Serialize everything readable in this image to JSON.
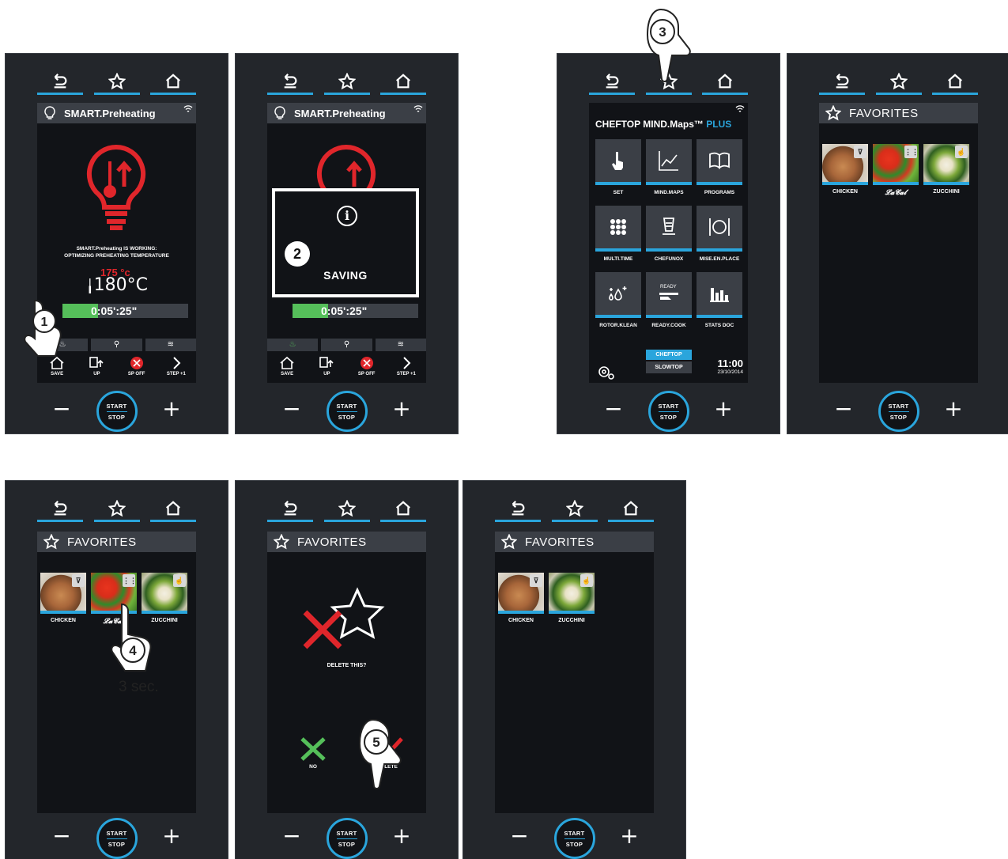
{
  "nav": {
    "back_icon": "back-icon",
    "star_icon": "star-icon",
    "home_icon": "home-icon"
  },
  "control": {
    "minus": "−",
    "plus": "+",
    "start": "START",
    "stop": "STOP"
  },
  "colors": {
    "accent": "#2aa5dc",
    "danger": "#e0262b",
    "ok": "#55bf5a"
  },
  "preheat": {
    "title": "SMART.Preheating",
    "working_line1": "SMART.Preheating IS WORKING:",
    "working_line2": "OPTIMIZING PREHEATING TEMPERATURE",
    "set_temp": "175 °c",
    "real_temp": "180°C",
    "timer": "0:05':25\"",
    "timer_progress": 0.28,
    "actions": [
      "SAVE",
      "UP",
      "SP OFF",
      "STEP +1"
    ]
  },
  "saving": {
    "label": "SAVING",
    "info": "i"
  },
  "mindmaps": {
    "title": "CHEFTOP MIND.Maps™",
    "title_plus": "PLUS",
    "tiles": [
      "SET",
      "MIND.MAPS",
      "PROGRAMS",
      "MULTI.TIME",
      "CHEFUNOX",
      "MISE.EN.PLACE",
      "ROTOR.KLEAN",
      "READY.COOK",
      "STATS DOC"
    ],
    "ready_badge": "READY",
    "cheftop": "CHEFTOP",
    "slowtop": "SLOWTOP",
    "time": "11:00",
    "date": "23/10/2014"
  },
  "favorites": {
    "title": "FAVORITES",
    "items": [
      "CHICKEN",
      "ZUCCHINI"
    ],
    "delete_question": "DELETE THIS?",
    "no": "NO",
    "delete": "DELETE"
  },
  "steps": {
    "s1": "1",
    "s2": "2",
    "s3": "3",
    "s4": "4",
    "s5": "5",
    "hold": "3 sec."
  }
}
